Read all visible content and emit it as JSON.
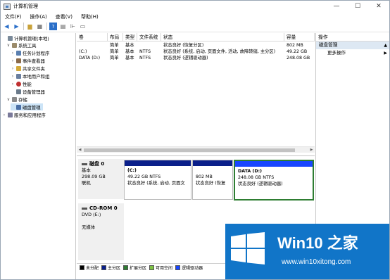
{
  "window": {
    "title": "计算机管理"
  },
  "window_controls": {
    "minimize": "—",
    "maximize": "☐",
    "close": "✕"
  },
  "menu": [
    "文件(F)",
    "操作(A)",
    "查看(V)",
    "帮助(H)"
  ],
  "tree": [
    {
      "label": "计算机管理(本地)",
      "expander": "",
      "icon_color": "#7a8a9a",
      "level": 0
    },
    {
      "label": "系统工具",
      "expander": "∨",
      "icon_color": "#9a8a6a",
      "level": 1
    },
    {
      "label": "任务计划程序",
      "expander": "›",
      "icon_color": "#5a7fb0",
      "level": 2
    },
    {
      "label": "事件查看器",
      "expander": "›",
      "icon_color": "#8a6a4a",
      "level": 2
    },
    {
      "label": "共享文件夹",
      "expander": "›",
      "icon_color": "#d4aa3a",
      "level": 2
    },
    {
      "label": "本地用户和组",
      "expander": "›",
      "icon_color": "#6a7fa0",
      "level": 2
    },
    {
      "label": "性能",
      "expander": "›",
      "icon_color": "#c03030",
      "level": 2
    },
    {
      "label": "设备管理器",
      "expander": "",
      "icon_color": "#6a7a8a",
      "level": 2
    },
    {
      "label": "存储",
      "expander": "∨",
      "icon_color": "#8a8a8a",
      "level": 1
    },
    {
      "label": "磁盘管理",
      "expander": "",
      "icon_color": "#4a6fa5",
      "level": 2,
      "selected": true
    },
    {
      "label": "服务和应用程序",
      "expander": "›",
      "icon_color": "#7a7a9a",
      "level": 1
    }
  ],
  "volume_table": {
    "headers": [
      "卷",
      "布局",
      "类型",
      "文件系统",
      "状态",
      "容量"
    ],
    "rows": [
      [
        "",
        "简单",
        "基本",
        "",
        "状态良好 (恢复分区)",
        "802 MB"
      ],
      [
        "(C:)",
        "简单",
        "基本",
        "NTFS",
        "状态良好 (系统, 启动, 页面文件, 活动, 故障转储, 主分区)",
        "49.22 GB"
      ],
      [
        "DATA (D:)",
        "简单",
        "基本",
        "NTFS",
        "状态良好 (逻辑驱动器)",
        "248.08 GB"
      ]
    ]
  },
  "disks": [
    {
      "name": "磁盘 0",
      "lines": [
        "基本",
        "298.09 GB",
        "联机"
      ],
      "partitions": [
        {
          "title": "(C:)",
          "size": "49.22 GB NTFS",
          "status": "状态良好 (系统, 启动, 页面文"
        },
        {
          "title": "",
          "size": "802 MB",
          "status": "状态良好 (恢复"
        },
        {
          "title": "DATA  (D:)",
          "size": "248.08 GB NTFS",
          "status": "状态良好 (逻辑驱动器)"
        }
      ]
    },
    {
      "name": "CD-ROM 0",
      "lines": [
        "DVD (E:)",
        "",
        "无媒体"
      ]
    }
  ],
  "legend": [
    {
      "label": "未分配",
      "color": "#000000"
    },
    {
      "label": "主分区",
      "color": "#0a1f8a"
    },
    {
      "label": "扩展分区",
      "color": "#2e7d32"
    },
    {
      "label": "可用空间",
      "color": "#7cc242"
    },
    {
      "label": "逻辑驱动器",
      "color": "#1846ff"
    }
  ],
  "actions": {
    "header": "操作",
    "section": "磁盘管理",
    "item": "更多操作"
  },
  "watermark": {
    "brand": "Win10 之家",
    "url": "www.win10xitong.com"
  }
}
